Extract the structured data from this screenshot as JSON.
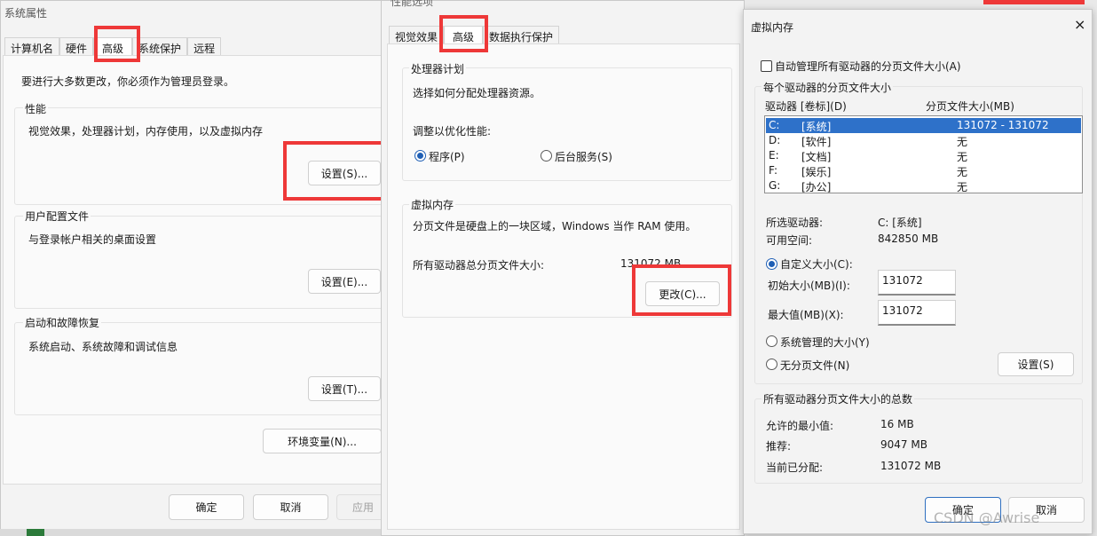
{
  "background_strip": {
    "accent": "#2b7a3a"
  },
  "sys_props": {
    "title": "系统属性",
    "tabs": [
      "计算机名",
      "硬件",
      "高级",
      "系统保护",
      "远程"
    ],
    "admin_note": "要进行大多数更改，你必须作为管理员登录。",
    "performance": {
      "title": "性能",
      "desc": "视觉效果，处理器计划，内存使用，以及虚拟内存",
      "button": "设置(S)..."
    },
    "profiles": {
      "title": "用户配置文件",
      "desc": "与登录帐户相关的桌面设置",
      "button": "设置(E)..."
    },
    "startup": {
      "title": "启动和故障恢复",
      "desc": "系统启动、系统故障和调试信息",
      "button": "设置(T)..."
    },
    "env_button": "环境变量(N)...",
    "ok": "确定",
    "cancel": "取消",
    "apply": "应用"
  },
  "perf_opts": {
    "title": "性能选项",
    "tabs": [
      "视觉效果",
      "高级",
      "数据执行保护"
    ],
    "processor": {
      "title": "处理器计划",
      "desc": "选择如何分配处理器资源。",
      "adjust_label": "调整以优化性能:",
      "opt_programs": "程序(P)",
      "opt_services": "后台服务(S)",
      "selected": "程序(P)"
    },
    "vm": {
      "title": "虚拟内存",
      "desc": "分页文件是硬盘上的一块区域，Windows 当作 RAM 使用。",
      "total_label": "所有驱动器总分页文件大小:",
      "total_value": "131072 MB",
      "change_button": "更改(C)..."
    }
  },
  "vmem": {
    "title": "虚拟内存",
    "close": "×",
    "auto_manage": "自动管理所有驱动器的分页文件大小(A)",
    "auto_checked": false,
    "group_title": "每个驱动器的分页文件大小",
    "col_drive": "驱动器 [卷标](D)",
    "col_size": "分页文件大小(MB)",
    "drives": [
      {
        "drive": "C:",
        "label": "[系统]",
        "size": "131072 - 131072",
        "selected": true
      },
      {
        "drive": "D:",
        "label": "[软件]",
        "size": "无",
        "selected": false
      },
      {
        "drive": "E:",
        "label": "[文档]",
        "size": "无",
        "selected": false
      },
      {
        "drive": "F:",
        "label": "[娱乐]",
        "size": "无",
        "selected": false
      },
      {
        "drive": "G:",
        "label": "[办公]",
        "size": "无",
        "selected": false
      }
    ],
    "selected_drive_label": "所选驱动器:",
    "selected_drive_value": "C:  [系统]",
    "free_space_label": "可用空间:",
    "free_space_value": "842850 MB",
    "custom_size": "自定义大小(C):",
    "initial_label": "初始大小(MB)(I):",
    "initial_value": "131072",
    "max_label": "最大值(MB)(X):",
    "max_value": "131072",
    "system_managed": "系统管理的大小(Y)",
    "no_paging": "无分页文件(N)",
    "set_button": "设置(S)",
    "totals_title": "所有驱动器分页文件大小的总数",
    "min_label": "允许的最小值:",
    "min_value": "16 MB",
    "rec_label": "推荐:",
    "rec_value": "9047 MB",
    "cur_label": "当前已分配:",
    "cur_value": "131072 MB",
    "ok": "确定",
    "cancel": "取消",
    "watermark": "CSDN @Awrise"
  },
  "colors": {
    "highlight": "#ee3838",
    "selection": "#2e71c9",
    "primary_border": "#2f6fc0"
  }
}
